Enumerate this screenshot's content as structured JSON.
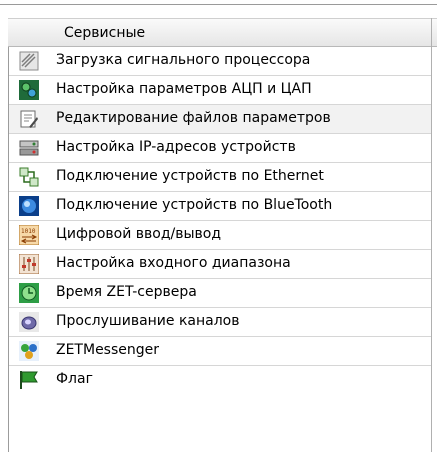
{
  "menu": {
    "title": "Сервисные",
    "items": [
      {
        "label": "Загрузка сигнального процессора",
        "icon": "chip-load-icon"
      },
      {
        "label": "Настройка параметров АЦП и ЦАП",
        "icon": "gears-icon"
      },
      {
        "label": "Редактирование файлов параметров",
        "icon": "file-edit-icon"
      },
      {
        "label": "Настройка IP-адресов устройств",
        "icon": "network-device-icon"
      },
      {
        "label": "Подключение устройств по Ethernet",
        "icon": "ethernet-icon"
      },
      {
        "label": "Подключение устройств по BlueTooth",
        "icon": "bluetooth-icon"
      },
      {
        "label": "Цифровой ввод/вывод",
        "icon": "digital-io-icon"
      },
      {
        "label": "Настройка входного диапазона",
        "icon": "sliders-icon"
      },
      {
        "label": "Время ZET-сервера",
        "icon": "clock-icon"
      },
      {
        "label": "Прослушивание каналов",
        "icon": "speaker-icon"
      },
      {
        "label": "ZETMessenger",
        "icon": "messenger-icon"
      },
      {
        "label": "Флаг",
        "icon": "flag-icon"
      }
    ]
  },
  "colors": {
    "header_bg": "#eeeeee",
    "hover_bg": "#f2f2f2",
    "separator": "#d6d6d6"
  }
}
